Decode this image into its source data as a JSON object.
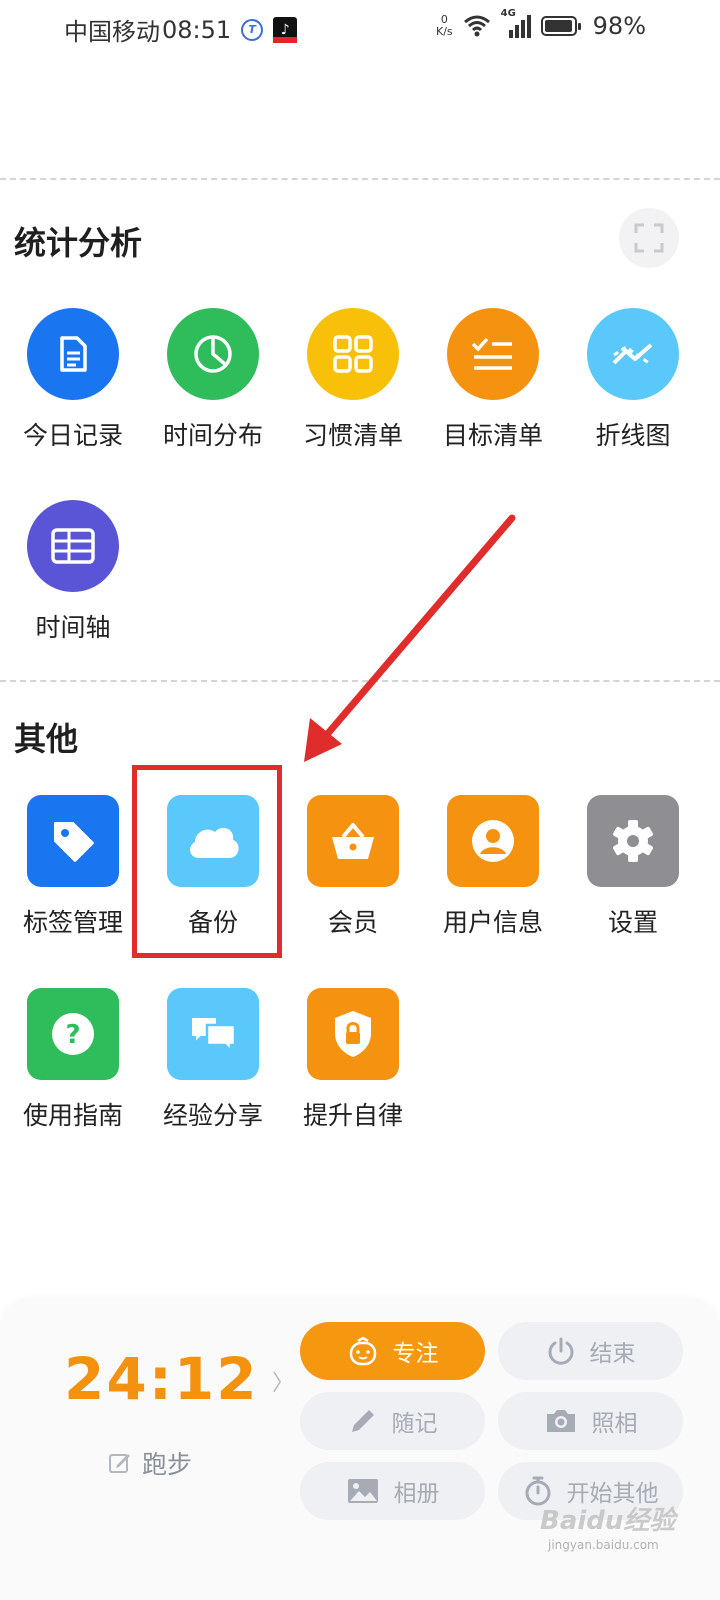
{
  "status_bar": {
    "carrier": "中国移动",
    "time": "08:51",
    "net_speed_value": "0",
    "net_speed_unit": "K/s",
    "network": "4G",
    "battery": "98%"
  },
  "stats_section": {
    "title": "统计分析",
    "items": [
      {
        "label": "今日记录",
        "icon": "document-icon",
        "color": "#1976f0"
      },
      {
        "label": "时间分布",
        "icon": "pie-chart-icon",
        "color": "#2fbd5c"
      },
      {
        "label": "习惯清单",
        "icon": "grid-icon",
        "color": "#f8c008"
      },
      {
        "label": "目标清单",
        "icon": "checklist-icon",
        "color": "#f5920f"
      },
      {
        "label": "折线图",
        "icon": "line-chart-icon",
        "color": "#5ac8fa"
      },
      {
        "label": "时间轴",
        "icon": "table-icon",
        "color": "#5a55d6"
      }
    ]
  },
  "other_section": {
    "title": "其他",
    "items": [
      {
        "label": "标签管理",
        "icon": "tag-icon",
        "color": "#1976f0"
      },
      {
        "label": "备份",
        "icon": "cloud-icon",
        "color": "#5ac8fa"
      },
      {
        "label": "会员",
        "icon": "basket-icon",
        "color": "#f5920f"
      },
      {
        "label": "用户信息",
        "icon": "user-icon",
        "color": "#f5920f"
      },
      {
        "label": "设置",
        "icon": "gear-icon",
        "color": "#8e8e93"
      },
      {
        "label": "使用指南",
        "icon": "question-icon",
        "color": "#2fbd5c"
      },
      {
        "label": "经验分享",
        "icon": "chat-icon",
        "color": "#5ac8fa"
      },
      {
        "label": "提升自律",
        "icon": "shield-lock-icon",
        "color": "#f5920f"
      }
    ]
  },
  "bottom_panel": {
    "timer": "24:12",
    "current_task": "跑步",
    "buttons": {
      "focus": "专注",
      "end": "结束",
      "note": "随记",
      "photo": "照相",
      "album": "相册",
      "start_other": "开始其他"
    }
  },
  "watermark": {
    "text": "Baidu经验",
    "url": "jingyan.baidu.com"
  },
  "colors": {
    "accent": "#f5970f",
    "highlight": "#e12c2c"
  }
}
